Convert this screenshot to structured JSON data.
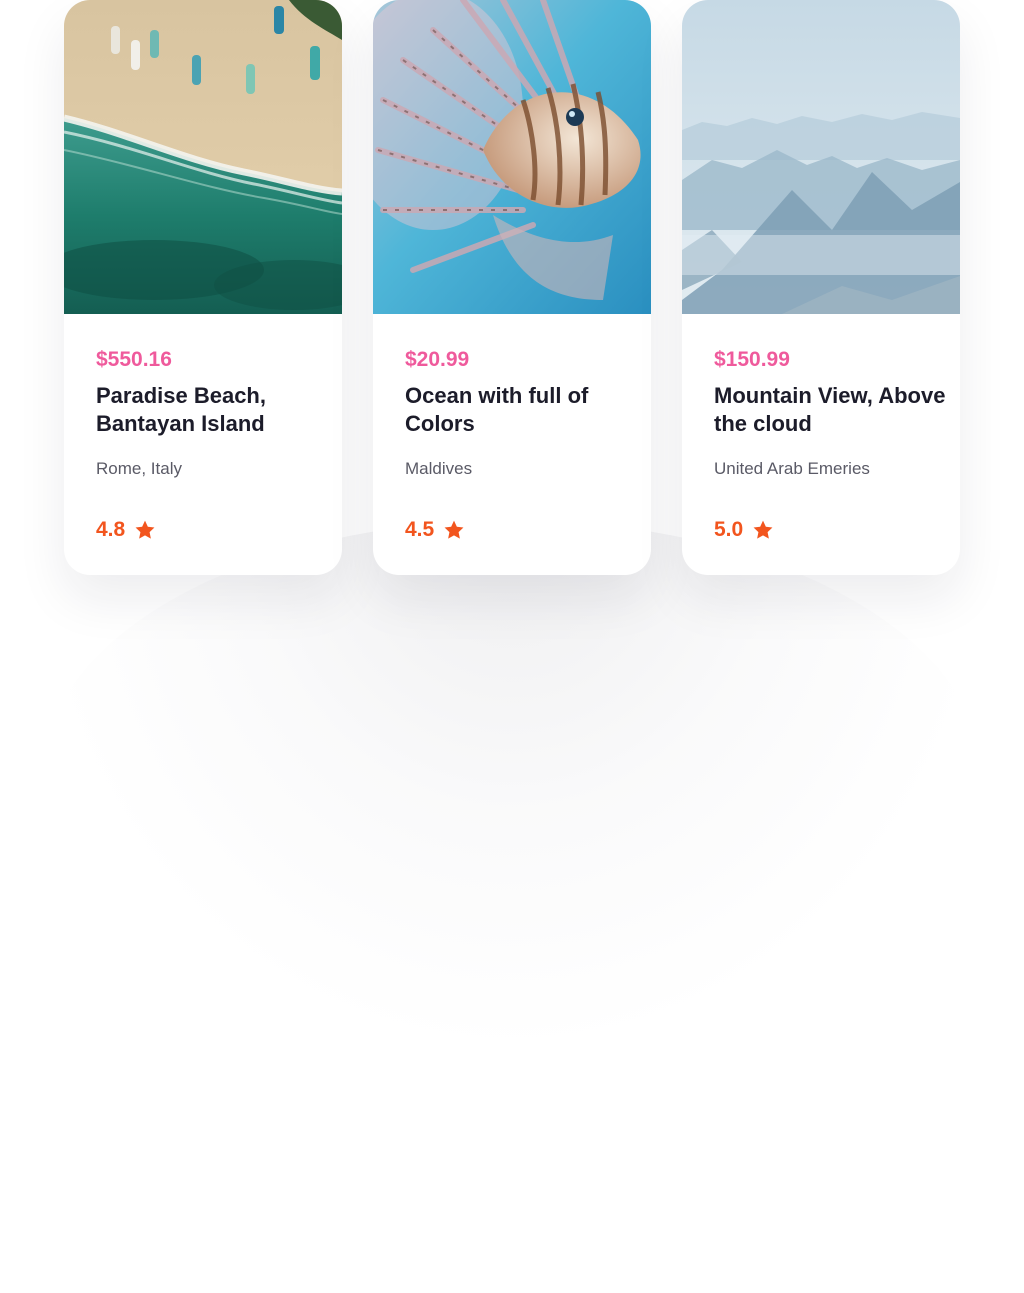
{
  "theme": {
    "price_color": "#ef5a9c",
    "rating_color": "#f2551e",
    "title_color": "#1c1c2a",
    "location_color": "#5a5a66"
  },
  "cards": [
    {
      "image": "beach-aerial-photo",
      "price": "$550.16",
      "title": "Paradise Beach, Bantayan Island",
      "location": "Rome, Italy",
      "rating": "4.8",
      "icon": "star-icon"
    },
    {
      "image": "lionfish-photo",
      "price": "$20.99",
      "title": "Ocean with full of Colors",
      "location": "Maldives",
      "rating": "4.5",
      "icon": "star-icon"
    },
    {
      "image": "misty-mountains-photo",
      "price": "$150.99",
      "title": "Mountain View, Above the cloud",
      "location": "United Arab Emeries",
      "rating": "5.0",
      "icon": "star-icon"
    }
  ]
}
